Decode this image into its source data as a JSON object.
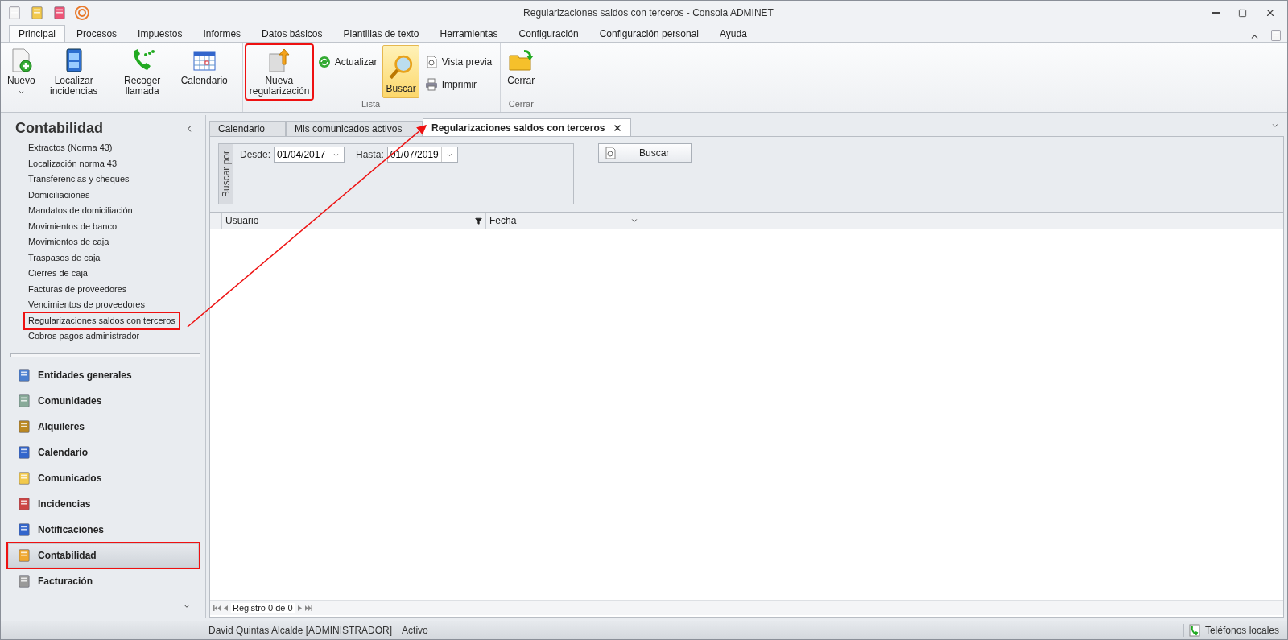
{
  "window": {
    "title": "Regularizaciones saldos con terceros - Consola ADMINET"
  },
  "ribbon_tabs": [
    {
      "label": "Principal",
      "selected": true
    },
    {
      "label": "Procesos",
      "selected": false
    },
    {
      "label": "Impuestos",
      "selected": false
    },
    {
      "label": "Informes",
      "selected": false
    },
    {
      "label": "Datos básicos",
      "selected": false
    },
    {
      "label": "Plantillas de texto",
      "selected": false
    },
    {
      "label": "Herramientas",
      "selected": false
    },
    {
      "label": "Configuración",
      "selected": false
    },
    {
      "label": "Configuración personal",
      "selected": false
    },
    {
      "label": "Ayuda",
      "selected": false
    }
  ],
  "ribbon_groups": [
    {
      "buttons": [
        {
          "kind": "large",
          "label": "Nuevo",
          "dropdown": true,
          "pressed": false,
          "highlighted": false
        },
        {
          "kind": "large",
          "label": "Localizar incidencias",
          "dropdown": false,
          "pressed": false,
          "highlighted": false
        },
        {
          "kind": "large",
          "label": "Recoger llamada",
          "dropdown": false,
          "pressed": false,
          "highlighted": false
        },
        {
          "kind": "large",
          "label": "Calendario",
          "dropdown": false,
          "pressed": false,
          "highlighted": false
        }
      ]
    },
    {
      "label": "Lista",
      "buttons": [
        {
          "kind": "large",
          "label": "Nueva regularización",
          "dropdown": false,
          "pressed": false,
          "highlighted": true
        },
        {
          "kind": "small",
          "label": "Actualizar",
          "dropdown": false,
          "pressed": false,
          "highlighted": false
        },
        {
          "kind": "large",
          "label": "Buscar",
          "dropdown": false,
          "pressed": true,
          "highlighted": false
        },
        {
          "kind": "small",
          "label": "Vista previa",
          "dropdown": false,
          "pressed": false,
          "highlighted": false
        },
        {
          "kind": "small",
          "label": "Imprimir",
          "dropdown": false,
          "pressed": false,
          "highlighted": false
        }
      ]
    },
    {
      "label": "Cerrar",
      "buttons": [
        {
          "kind": "large",
          "label": "Cerrar",
          "dropdown": false,
          "pressed": false,
          "highlighted": false
        }
      ]
    }
  ],
  "sidebar": {
    "title": "Contabilidad",
    "items": [
      {
        "label": "Extractos (Norma 43)",
        "highlighted": false
      },
      {
        "label": "Localización norma 43",
        "highlighted": false
      },
      {
        "label": "Transferencias y cheques",
        "highlighted": false
      },
      {
        "label": "Domiciliaciones",
        "highlighted": false
      },
      {
        "label": "Mandatos de domiciliación",
        "highlighted": false
      },
      {
        "label": "Movimientos de banco",
        "highlighted": false
      },
      {
        "label": "Movimientos de caja",
        "highlighted": false
      },
      {
        "label": "Traspasos de caja",
        "highlighted": false
      },
      {
        "label": "Cierres de caja",
        "highlighted": false
      },
      {
        "label": "Facturas de proveedores",
        "highlighted": false
      },
      {
        "label": "Vencimientos de proveedores",
        "highlighted": false
      },
      {
        "label": "Regularizaciones saldos con terceros",
        "highlighted": true
      },
      {
        "label": "Cobros pagos administrador",
        "highlighted": false
      }
    ],
    "nav": [
      {
        "label": "Entidades generales",
        "selected": false,
        "highlighted": false
      },
      {
        "label": "Comunidades",
        "selected": false,
        "highlighted": false
      },
      {
        "label": "Alquileres",
        "selected": false,
        "highlighted": false
      },
      {
        "label": "Calendario",
        "selected": false,
        "highlighted": false
      },
      {
        "label": "Comunicados",
        "selected": false,
        "highlighted": false
      },
      {
        "label": "Incidencias",
        "selected": false,
        "highlighted": false
      },
      {
        "label": "Notificaciones",
        "selected": false,
        "highlighted": false
      },
      {
        "label": "Contabilidad",
        "selected": true,
        "highlighted": true
      },
      {
        "label": "Facturación",
        "selected": false,
        "highlighted": false
      }
    ]
  },
  "doc_tabs": [
    {
      "label": "Calendario",
      "selected": false
    },
    {
      "label": "Mis comunicados activos",
      "selected": false
    },
    {
      "label": "Regularizaciones saldos con terceros",
      "selected": true
    }
  ],
  "filter": {
    "group_label": "Buscar por",
    "fields": [
      {
        "label": "Desde:",
        "value": "01/04/2017"
      },
      {
        "label": "Hasta:",
        "value": "01/07/2019"
      }
    ],
    "button": "Buscar"
  },
  "table": {
    "columns": [
      {
        "label": "Usuario",
        "kind": "filter"
      },
      {
        "label": "Fecha",
        "kind": "sort"
      }
    ],
    "navigator": "Registro 0 de 0"
  },
  "status_bar": {
    "user": "David Quintas Alcalde [ADMINISTRADOR]",
    "state": "Activo",
    "phones": "Teléfonos locales"
  },
  "annotation": {
    "arrow": true
  }
}
